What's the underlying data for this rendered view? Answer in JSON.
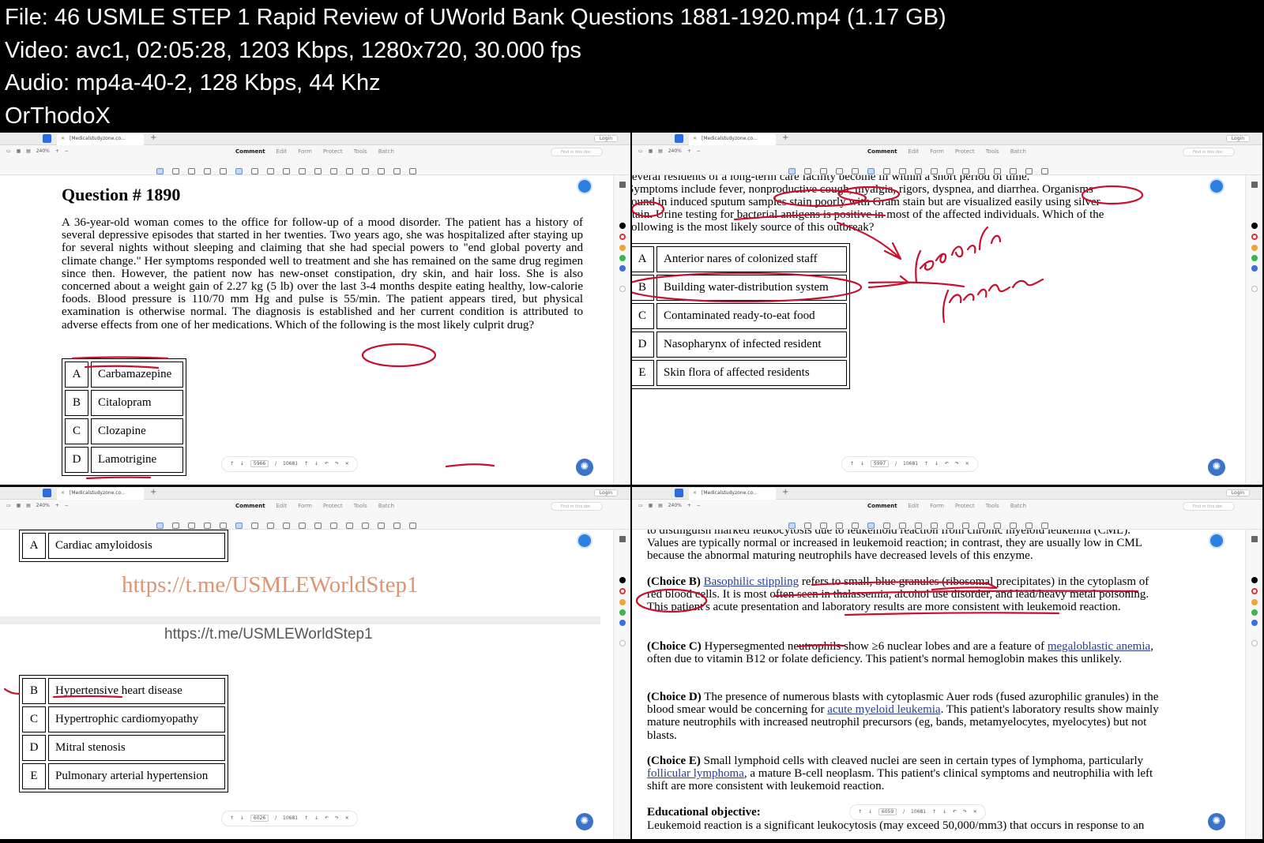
{
  "header": {
    "lines": [
      "File: 46  USMLE  STEP 1  Rapid Review of UWorld Bank Questions 1881-1920.mp4 (1.17 GB)",
      "Video: avc1, 02:05:28, 1203 Kbps, 1280x720, 30.000 fps",
      "Audio: mp4a-40-2, 128 Kbps, 44 Khz",
      "OrThodoX"
    ]
  },
  "app": {
    "tab_label": "[Medicalstudyzone.co...",
    "login": "Login",
    "zoom": "240%",
    "menus": [
      "Comment",
      "Edit",
      "Form",
      "Protect",
      "Tools",
      "Batch"
    ],
    "active_menu": "Comment",
    "search_placeholder": "Find in this doc",
    "total_pages": "10681",
    "colors": {
      "ink": "#c8102e",
      "accent": "#2d80e0"
    }
  },
  "panel1": {
    "page": "5966",
    "title": "Question # 1890",
    "stem": "A 36-year-old woman comes to the office for follow-up of a mood disorder.  The patient has a history of several depressive episodes that started in her twenties.  Two years ago, she was hospitalized after staying up for several nights without sleeping and claiming that she had special powers to \"end global poverty and climate change.\"  Her symptoms responded well to treatment and she has remained on the same drug regimen since then.  However, the patient now has new-onset constipation, dry skin, and hair loss.  She is also concerned about a weight gain of 2.27 kg (5 lb) over the last 3-4 months despite eating healthy, low-calorie foods.  Blood pressure is 110/70 mm Hg and pulse is 55/min.  The patient appears tired, but physical examination is otherwise normal.  The diagnosis is established and her current condition is attributed to adverse effects from one of her medications.  Which of the following is the most likely culprit drug?",
    "choices": [
      {
        "letter": "A",
        "text": "Carbamazepine"
      },
      {
        "letter": "B",
        "text": "Citalopram"
      },
      {
        "letter": "C",
        "text": "Clozapine"
      },
      {
        "letter": "D",
        "text": "Lamotrigine"
      }
    ]
  },
  "panel2": {
    "page": "5997",
    "stem_lines": [
      "several residents of a long-term care facility become ill within a short period of time.",
      "Symptoms include fever, nonproductive cough, myalgia, rigors, dyspnea, and diarrhea.  Organisms",
      "found in induced sputum samples stain poorly with Gram stain but are visualized easily using silver",
      "stain.  Urine testing for bacterial antigens is positive in most of the affected individuals.  Which of the",
      "following is the most likely source of this outbreak?"
    ],
    "choices": [
      {
        "letter": "A",
        "text": "Anterior nares of colonized staff"
      },
      {
        "letter": "B",
        "text": "Building water-distribution system"
      },
      {
        "letter": "C",
        "text": "Contaminated ready-to-eat food"
      },
      {
        "letter": "D",
        "text": "Nasopharynx of infected resident"
      },
      {
        "letter": "E",
        "text": "Skin flora of affected residents"
      }
    ]
  },
  "panel3": {
    "page": "6026",
    "choice_top": {
      "letter": "A",
      "text": "Cardiac amyloidosis"
    },
    "tg_link": "https://t.me/USMLEWorldStep1",
    "tg_plain": "https://t.me/USMLEWorldStep1",
    "choices": [
      {
        "letter": "B",
        "text": "Hypertensive heart disease"
      },
      {
        "letter": "C",
        "text": "Hypertrophic cardiomyopathy"
      },
      {
        "letter": "D",
        "text": "Mitral stenosis"
      },
      {
        "letter": "E",
        "text": "Pulmonary arterial hypertension"
      }
    ]
  },
  "panel4": {
    "page": "6059",
    "intro": "to distinguish marked leukocytosis due to leukemoid reaction from chronic myeloid leukemia (CML).  Values are typically normal or increased in leukemoid reaction; in contrast, they are usually low in CML because the abnormal maturing neutrophils have decreased levels of this enzyme.",
    "b_head": "(Choice B)",
    "b_link": "Basophilic stippling",
    "b_text": " refers to small, blue granules (ribosomal precipitates) in the cytoplasm of red blood cells.  It is most often seen in thalassemia, alcohol use disorder, and lead/heavy metal poisoning.  This patient's acute presentation and laboratory results are more consistent with leukemoid reaction.",
    "c_head": "(Choice C)",
    "c_text1": "  Hypersegmented neutrophils show ≥6 nuclear lobes and are a feature of ",
    "c_link": "megaloblastic anemia",
    "c_text2": ", often due to vitamin B12 or folate deficiency.  This patient's normal hemoglobin makes this unlikely.",
    "d_head": "(Choice D)",
    "d_text1": "  The presence of numerous blasts with cytoplasmic Auer rods (fused azurophilic granules) in the blood smear would be concerning for ",
    "d_link": "acute myeloid leukemia",
    "d_text2": ".  This patient's laboratory results show mainly mature neutrophils with increased neutrophil precursors (eg, bands, metamyelocytes, myelocytes) but not blasts.",
    "e_head": "(Choice E)",
    "e_text1": "  Small lymphoid cells with cleaved nuclei are seen in certain types of lymphoma, particularly ",
    "e_link": "follicular lymphoma",
    "e_text2": ", a mature B-cell neoplasm.  This patient's clinical symptoms and neutrophilia with left shift are more consistent with leukemoid reaction.",
    "edu_head": "Educational objective:",
    "edu_text": "Leukemoid reaction is a significant leukocytosis (may exceed 50,000/mm3) that occurs in response to an"
  }
}
